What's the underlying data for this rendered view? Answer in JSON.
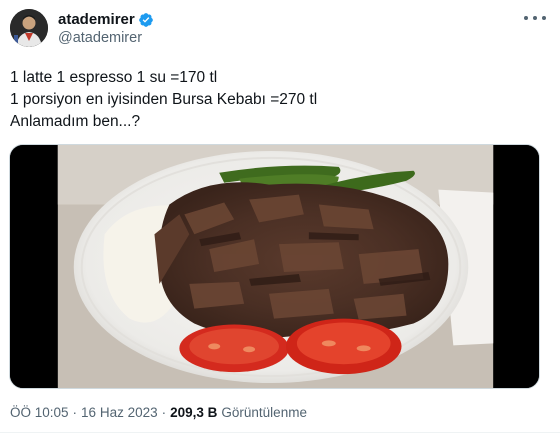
{
  "author": {
    "display_name": "atademirer",
    "handle": "@atademirer",
    "verified": true
  },
  "tweet": {
    "lines": [
      "1 latte 1 espresso 1 su =170 tl",
      "1 porsiyon en iyisinden Bursa Kebabı =270 tl",
      "Anlamadım ben...?"
    ]
  },
  "media": {
    "description": "iskender-kebab-plate-photo"
  },
  "meta": {
    "time": "ÖÖ 10:05",
    "date": "16 Haz 2023",
    "views_count": "209,3 B",
    "views_label": "Görüntülenme"
  },
  "colors": {
    "verified": "#1d9bf0",
    "secondary_text": "#536471",
    "primary_text": "#0f1419"
  },
  "icons": [
    "avatar",
    "verified-badge-icon",
    "more-options-icon"
  ]
}
